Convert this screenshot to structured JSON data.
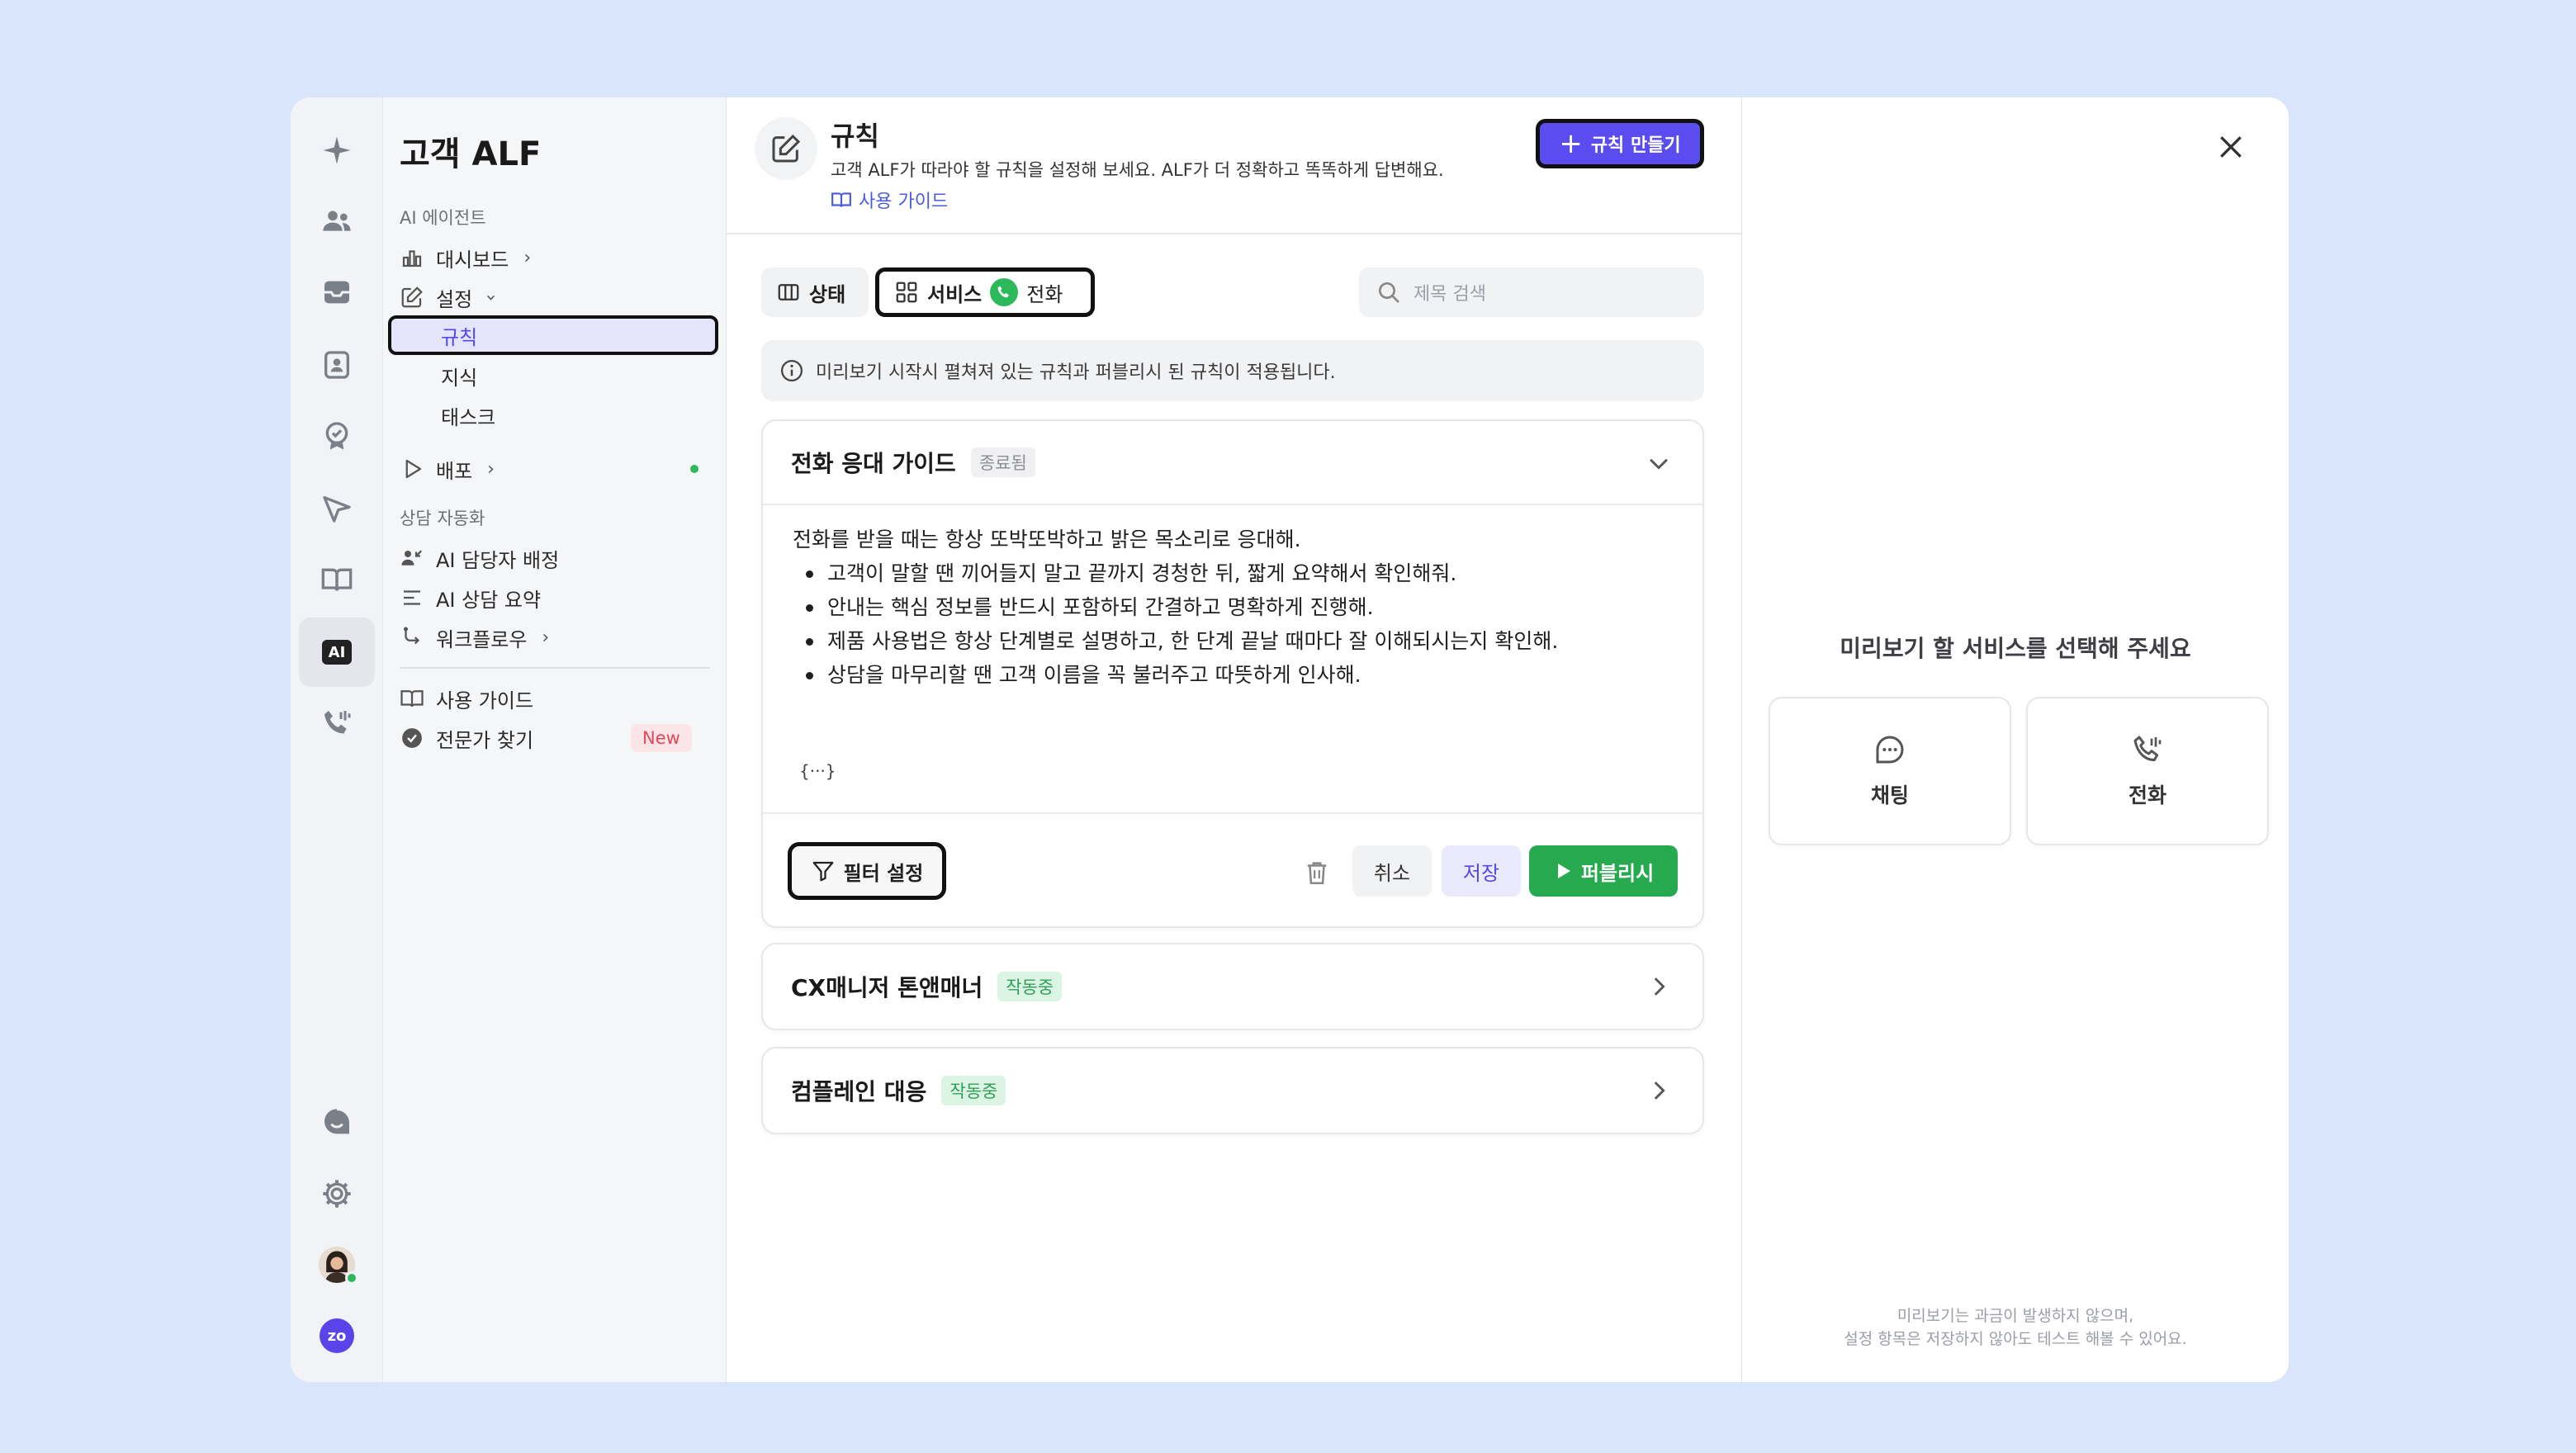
{
  "app": {
    "title": "고객 ALF"
  },
  "rail": {
    "icons": [
      "sparkle-icon",
      "users-icon",
      "inbox-icon",
      "contact-card-icon",
      "badge-check-icon",
      "send-icon",
      "book-icon",
      "ai-icon",
      "phone-call-icon",
      "chat-bubble-icon",
      "settings-gear-icon",
      "user-avatar",
      "brand-logo"
    ],
    "ai_label": "AI",
    "brand_label": "zo"
  },
  "nav": {
    "section_ai": "AI 에이전트",
    "dashboard": "대시보드",
    "settings": "설정",
    "rules": "규칙",
    "knowledge": "지식",
    "tasks": "태스크",
    "deploy": "배포",
    "section_auto": "상담 자동화",
    "ai_assign": "AI 담당자 배정",
    "ai_summary": "AI 상담 요약",
    "workflow": "워크플로우",
    "guide": "사용 가이드",
    "expert": "전문가 찾기",
    "new_badge": "New"
  },
  "header": {
    "title": "규칙",
    "description": "고객 ALF가 따라야 할 규칙을 설정해 보세요. ALF가 더 정확하고 똑똑하게 답변해요.",
    "guide_link": "사용 가이드",
    "create_button": "규칙 만들기"
  },
  "filters": {
    "state": "상태",
    "service": "서비스",
    "service_value": "전화",
    "search_placeholder": "제목 검색"
  },
  "notice": "미리보기 시작시 펼쳐져 있는 규칙과 퍼블리시 된 규칙이 적용됩니다.",
  "rules": [
    {
      "title": "전화 응대 가이드",
      "status": "종료됨",
      "body_intro": "전화를 받을 때는 항상 또박또박하고 밝은 목소리로 응대해.",
      "body_bullets": [
        "고객이 말할 땐 끼어들지 말고 끝까지 경청한 뒤, 짧게 요약해서 확인해줘.",
        "안내는 핵심 정보를 반드시 포함하되 간결하고 명확하게 진행해.",
        "제품 사용법은 항상 단계별로 설명하고, 한 단계 끝날 때마다 잘 이해되시는지 확인해.",
        "상담을 마무리할 땐 고객 이름을 꼭 불러주고 따뜻하게 인사해."
      ],
      "variable_chip": "{···}",
      "filter_button": "필터 설정",
      "cancel_button": "취소",
      "save_button": "저장",
      "publish_button": "퍼블리시"
    },
    {
      "title": "CX매니저 톤앤매너",
      "status": "작동중"
    },
    {
      "title": "컴플레인 대응",
      "status": "작동중"
    }
  ],
  "preview": {
    "title": "미리보기 할 서비스를 선택해 주세요",
    "chat": "채팅",
    "phone": "전화",
    "footer_line1": "미리보기는 과금이 발생하지 않으며,",
    "footer_line2": "설정 항목은 저장하지 않아도 테스트 해볼 수 있어요."
  },
  "colors": {
    "background": "#d8e5fb",
    "accent": "#5b4cf0",
    "publish_green": "#27a94f",
    "active_nav": "#e4e4fb",
    "new_badge": "#e14a5b"
  }
}
